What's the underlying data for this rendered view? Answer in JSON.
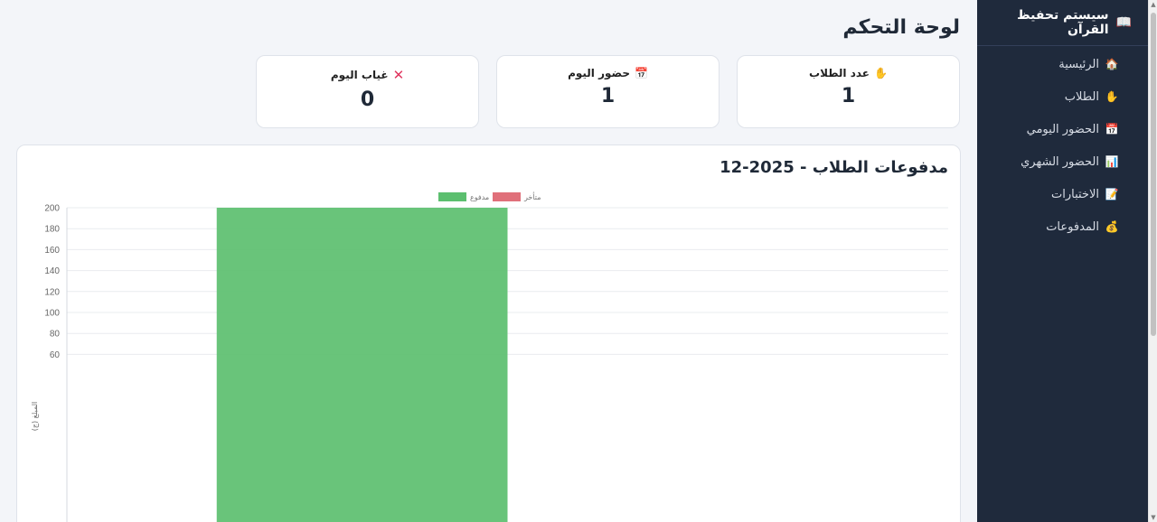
{
  "sidebar": {
    "title": "سيستم تحفيظ القرآن",
    "items": [
      {
        "label": "الرئيسية",
        "icon": "house-icon"
      },
      {
        "label": "الطلاب",
        "icon": "hand-icon"
      },
      {
        "label": "الحضور اليومي",
        "icon": "calendar-icon"
      },
      {
        "label": "الحضور الشهري",
        "icon": "bar-chart-icon"
      },
      {
        "label": "الاختبارات",
        "icon": "memo-icon"
      },
      {
        "label": "المدفوعات",
        "icon": "money-bag-icon"
      }
    ]
  },
  "page": {
    "title": "لوحة التحكم"
  },
  "cards": [
    {
      "label": "عدد الطلاب",
      "value": "1",
      "icon": "hand-icon"
    },
    {
      "label": "حضور اليوم",
      "value": "1",
      "icon": "calendar-icon"
    },
    {
      "label": "غياب اليوم",
      "value": "0",
      "icon": "cross-icon"
    }
  ],
  "chart_panel": {
    "title": "مدفوعات الطلاب - 2025-12"
  },
  "chart_data": {
    "type": "bar",
    "title": "مدفوعات الطلاب - 2025-12",
    "categories": [
      ""
    ],
    "series": [
      {
        "name": "مدفوع",
        "values": [
          200
        ],
        "color": "#5cbf6f"
      },
      {
        "name": "متأخر",
        "values": [
          0
        ],
        "color": "#e0707a"
      }
    ],
    "ylabel": "المبلغ (ج)",
    "xlabel": "",
    "y_ticks": [
      60,
      80,
      100,
      120,
      140,
      160,
      180,
      200
    ],
    "ylim": [
      0,
      200
    ],
    "grid": true,
    "legend": "top-center"
  }
}
